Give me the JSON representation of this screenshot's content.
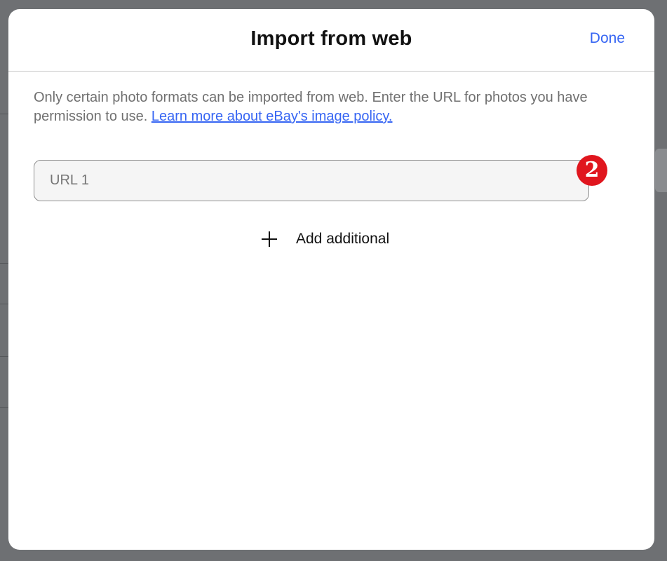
{
  "modal": {
    "title": "Import from web",
    "done_label": "Done",
    "description_text": "Only certain photo formats can be imported from web. Enter the URL for photos you have permission to use. ",
    "policy_link": "Learn more about eBay's image policy.",
    "url_input": {
      "placeholder": "URL 1",
      "value": ""
    },
    "badge_number": "2",
    "add_additional_label": "Add additional"
  },
  "colors": {
    "accent": "#3665f3",
    "badge": "#e0161e",
    "overlay": "#6e7073"
  },
  "icons": {
    "add": "plus-icon"
  }
}
